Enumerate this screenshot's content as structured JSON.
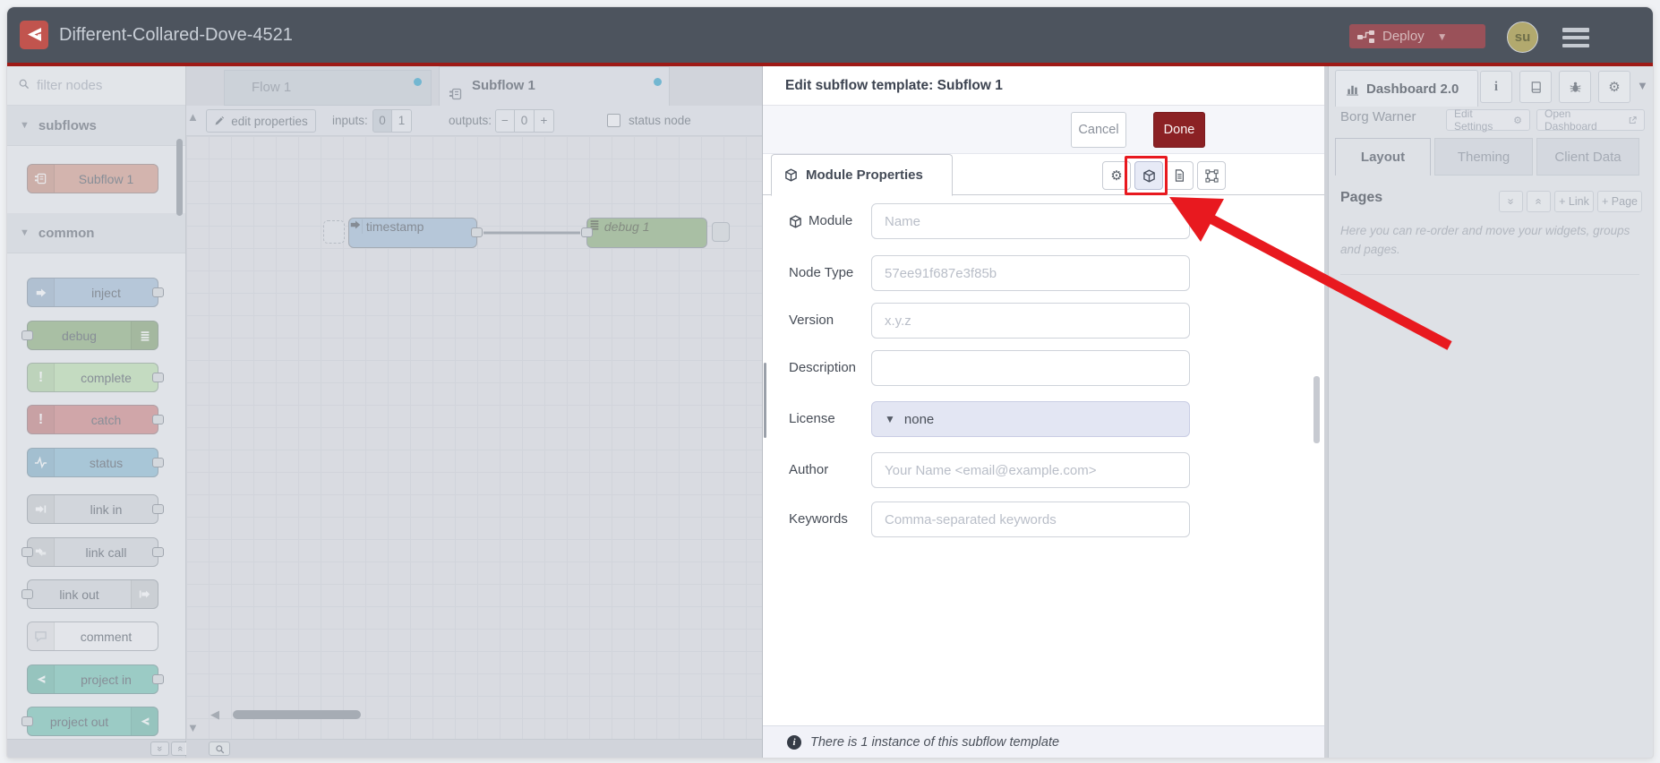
{
  "header": {
    "title": "Different-Collared-Dove-4521",
    "deploy_label": "Deploy",
    "avatar_text": "su"
  },
  "palette": {
    "filter_placeholder": "filter nodes",
    "categories": [
      {
        "label": "subflows",
        "nodes": [
          {
            "label": "Subflow 1"
          }
        ]
      },
      {
        "label": "common",
        "nodes": [
          {
            "label": "inject"
          },
          {
            "label": "debug"
          },
          {
            "label": "complete"
          },
          {
            "label": "catch"
          },
          {
            "label": "status"
          },
          {
            "label": "link in"
          },
          {
            "label": "link call"
          },
          {
            "label": "link out"
          },
          {
            "label": "comment"
          },
          {
            "label": "project in"
          },
          {
            "label": "project out"
          }
        ]
      }
    ]
  },
  "workspace": {
    "tabs": [
      {
        "label": "Flow 1"
      },
      {
        "label": "Subflow 1"
      }
    ],
    "toolbar": {
      "edit_properties_label": "edit properties",
      "inputs_label": "inputs:",
      "input_options": [
        "0",
        "1"
      ],
      "outputs_label": "outputs:",
      "outputs_minus": "−",
      "outputs_count": "0",
      "outputs_plus": "+",
      "status_node_label": "status node"
    },
    "nodes": [
      {
        "label": "timestamp"
      },
      {
        "label": "debug 1"
      }
    ]
  },
  "dialog": {
    "title": "Edit subflow template: Subflow 1",
    "cancel_label": "Cancel",
    "done_label": "Done",
    "tab_label": "Module Properties",
    "fields": {
      "module": {
        "label": "Module",
        "placeholder": "Name"
      },
      "node_type": {
        "label": "Node Type",
        "placeholder": "57ee91f687e3f85b"
      },
      "version": {
        "label": "Version",
        "placeholder": "x.y.z"
      },
      "description": {
        "label": "Description",
        "placeholder": ""
      },
      "license": {
        "label": "License",
        "value": "none"
      },
      "author": {
        "label": "Author",
        "placeholder": "Your Name <email@example.com>"
      },
      "keywords": {
        "label": "Keywords",
        "placeholder": "Comma-separated keywords"
      }
    },
    "footer_text": "There is 1 instance of this subflow template"
  },
  "sidebar": {
    "active_tab": "Dashboard 2.0",
    "project_name": "Borg Warner",
    "edit_settings_label": "Edit Settings",
    "open_dashboard_label": "Open Dashboard",
    "tabs": [
      "Layout",
      "Theming",
      "Client Data"
    ],
    "pages_title": "Pages",
    "add_link_label": "+ Link",
    "add_page_label": "+ Page",
    "help_text": "Here you can re-order and move your widgets, groups and pages."
  },
  "colors": {
    "header_bg": "#4d545e",
    "accent_red_line": "#9e1a16",
    "deploy_bg": "#9a5159",
    "done_button": "#8b2124",
    "annotation_red": "#e8191f",
    "node_subflow": "#d7a294",
    "node_inject": "#a8c0d8",
    "node_debug": "#94b383",
    "node_complete": "#bfe0b2",
    "node_catch": "#d28c8c",
    "node_status": "#92bed6",
    "node_link": "#d6d9de",
    "node_project": "#7cc7b8",
    "unsaved_dot": "#3da6cc"
  }
}
